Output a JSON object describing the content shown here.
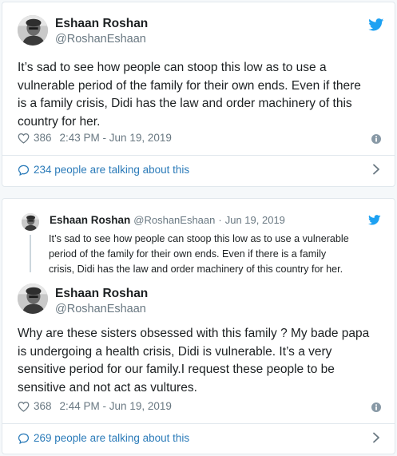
{
  "tweets": [
    {
      "author": {
        "name": "Eshaan Roshan",
        "handle": "@RoshanEshaan"
      },
      "text_lines": [
        "It’s sad to see how people can stoop this low as to use a",
        "vulnerable period of the family for their own ends.  Even if there",
        "is a family crisis, Didi has the law and order machinery of this",
        "country for her."
      ],
      "likes": "386",
      "time": "2:43 PM - Jun 19, 2019",
      "talking": "234 people are talking about this"
    },
    {
      "quoted": {
        "name": "Eshaan Roshan",
        "handle": "@RoshanEshaan",
        "separator": "·",
        "date": "Jun 19, 2019",
        "text_lines": [
          "It’s sad to see how people can stoop this low as to use a vulnerable",
          "period of the family for their own ends.  Even if there is a family",
          "crisis, Didi has the law and order machinery of this country for her."
        ]
      },
      "author": {
        "name": "Eshaan Roshan",
        "handle": "@RoshanEshaan"
      },
      "text_lines": [
        "Why are these sisters obsessed with this family ? My bade papa",
        "is undergoing a health crisis, Didi is vulnerable. It’s a very",
        "sensitive period for our family.I request these people to be",
        "sensitive and not act as vultures."
      ],
      "likes": "368",
      "time": "2:44 PM - Jun 19, 2019",
      "talking": "269 people are talking about this"
    }
  ],
  "icons": {
    "twitter": "twitter-bird-icon",
    "like": "heart-icon",
    "info": "info-icon",
    "reply": "speech-bubble-icon",
    "more": "chevron-right-icon"
  },
  "colors": {
    "twitter_blue": "#1da1f2",
    "link": "#2b7bb9",
    "muted": "#697882",
    "text": "#1c2022",
    "border": "#e1e8ed"
  }
}
